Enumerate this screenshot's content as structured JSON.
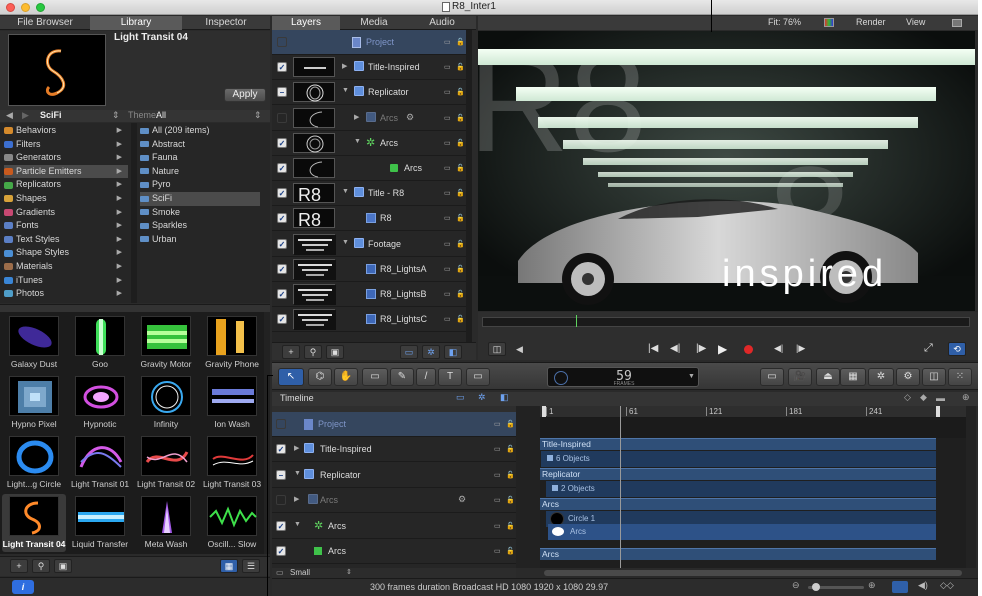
{
  "window_title": "R8_Inter1",
  "left_tabs": [
    "File Browser",
    "Library",
    "Inspector"
  ],
  "preview": {
    "title": "Light Transit 04",
    "apply_label": "Apply"
  },
  "library_nav": {
    "folder": "SciFi",
    "theme_label": "Theme:",
    "theme_value": "All"
  },
  "categories": [
    {
      "label": "Behaviors",
      "color": "#d58a2c"
    },
    {
      "label": "Filters",
      "color": "#3c6fd0"
    },
    {
      "label": "Generators",
      "color": "#888888"
    },
    {
      "label": "Particle Emitters",
      "color": "#c85a1e",
      "selected": true
    },
    {
      "label": "Replicators",
      "color": "#45a848"
    },
    {
      "label": "Shapes",
      "color": "#d7a23a"
    },
    {
      "label": "Gradients",
      "color": "#c74872"
    },
    {
      "label": "Fonts",
      "color": "#5b7fc5"
    },
    {
      "label": "Text Styles",
      "color": "#5b7fc5"
    },
    {
      "label": "Shape Styles",
      "color": "#4b8fd5"
    },
    {
      "label": "Materials",
      "color": "#9c6d4a"
    },
    {
      "label": "iTunes",
      "color": "#3a86d6"
    },
    {
      "label": "Photos",
      "color": "#4f9ec9"
    }
  ],
  "subfolders": [
    {
      "label": "All (209 items)"
    },
    {
      "label": "Abstract"
    },
    {
      "label": "Fauna"
    },
    {
      "label": "Nature"
    },
    {
      "label": "Pyro"
    },
    {
      "label": "SciFi",
      "selected": true
    },
    {
      "label": "Smoke"
    },
    {
      "label": "Sparkles"
    },
    {
      "label": "Urban"
    }
  ],
  "thumbnails": [
    {
      "label": "Galaxy Dust"
    },
    {
      "label": "Goo"
    },
    {
      "label": "Gravity Motor"
    },
    {
      "label": "Gravity Phone"
    },
    {
      "label": "Hypno Pixel"
    },
    {
      "label": "Hypnotic"
    },
    {
      "label": "Infinity"
    },
    {
      "label": "Ion Wash"
    },
    {
      "label": "Light...g Circle"
    },
    {
      "label": "Light Transit 01"
    },
    {
      "label": "Light Transit 02"
    },
    {
      "label": "Light Transit 03"
    },
    {
      "label": "Light Transit 04",
      "selected": true
    },
    {
      "label": "Liquid Transfer"
    },
    {
      "label": "Meta Wash"
    },
    {
      "label": "Oscill... Slow"
    }
  ],
  "layer_tabs": [
    "Layers",
    "Media",
    "Audio"
  ],
  "layers": [
    {
      "name": "Project",
      "indent": 0,
      "checked": "none",
      "highlight": true,
      "thumb": "none",
      "dim": false
    },
    {
      "name": "Title-Inspired",
      "indent": 0,
      "checked": "check",
      "thumb": "text-small",
      "expand": "right",
      "group": true
    },
    {
      "name": "Replicator",
      "indent": 0,
      "checked": "minus",
      "thumb": "rings",
      "expand": "down",
      "group": true
    },
    {
      "name": "Arcs",
      "indent": 1,
      "checked": "none",
      "thumb": "arc",
      "expand": "right",
      "group": true,
      "dim": true
    },
    {
      "name": "Arcs",
      "indent": 1,
      "checked": "check",
      "thumb": "arcs",
      "expand": "down",
      "green": true
    },
    {
      "name": "Arcs",
      "indent": 2,
      "checked": "check",
      "thumb": "arc",
      "leaf": "green"
    },
    {
      "name": "Title - R8",
      "indent": 0,
      "checked": "check",
      "thumb": "R8",
      "expand": "down",
      "group": true
    },
    {
      "name": "R8",
      "indent": 1,
      "checked": "check",
      "thumb": "R8",
      "leaf": "text"
    },
    {
      "name": "Footage",
      "indent": 0,
      "checked": "check",
      "thumb": "lights",
      "expand": "down",
      "group": true
    },
    {
      "name": "R8_LightsA",
      "indent": 1,
      "checked": "check",
      "thumb": "lights",
      "leaf": "film"
    },
    {
      "name": "R8_LightsB",
      "indent": 1,
      "checked": "check",
      "thumb": "lights",
      "leaf": "film"
    },
    {
      "name": "R8_LightsC",
      "indent": 1,
      "checked": "check",
      "thumb": "lights",
      "leaf": "film"
    }
  ],
  "canvas_bar": {
    "fit": "Fit: 76%",
    "render": "Render",
    "view": "View"
  },
  "canvas_text": "inspired",
  "timecode": {
    "value": "59",
    "unit": "FRAMES"
  },
  "timeline": {
    "title": "Timeline",
    "ruler_marks": [
      "1",
      "61",
      "121",
      "181",
      "241"
    ],
    "rows": [
      {
        "name": "Project",
        "checked": "none",
        "highlight": true
      },
      {
        "name": "Title-Inspired",
        "checked": "check",
        "expand": "right"
      },
      {
        "name": "Replicator",
        "checked": "minus",
        "expand": "down"
      },
      {
        "name": "Arcs",
        "checked": "none",
        "expand": "right",
        "dim": true
      },
      {
        "name": "Arcs",
        "checked": "check",
        "expand": "down"
      },
      {
        "name": "Arcs",
        "checked": "check"
      }
    ],
    "track_bars": [
      {
        "label": "Title-Inspired",
        "sub": "6 Objects"
      },
      {
        "label": "Replicator",
        "sub": "2 Objects"
      },
      {
        "label": "Arcs",
        "sub": "Circle 1"
      },
      {
        "label": "",
        "sub": "Arcs"
      },
      {
        "label": "Arcs",
        "sub": ""
      }
    ],
    "size_label": "Small"
  },
  "status_text": "300 frames duration Broadcast HD 1080 1920 x 1080 29.97"
}
